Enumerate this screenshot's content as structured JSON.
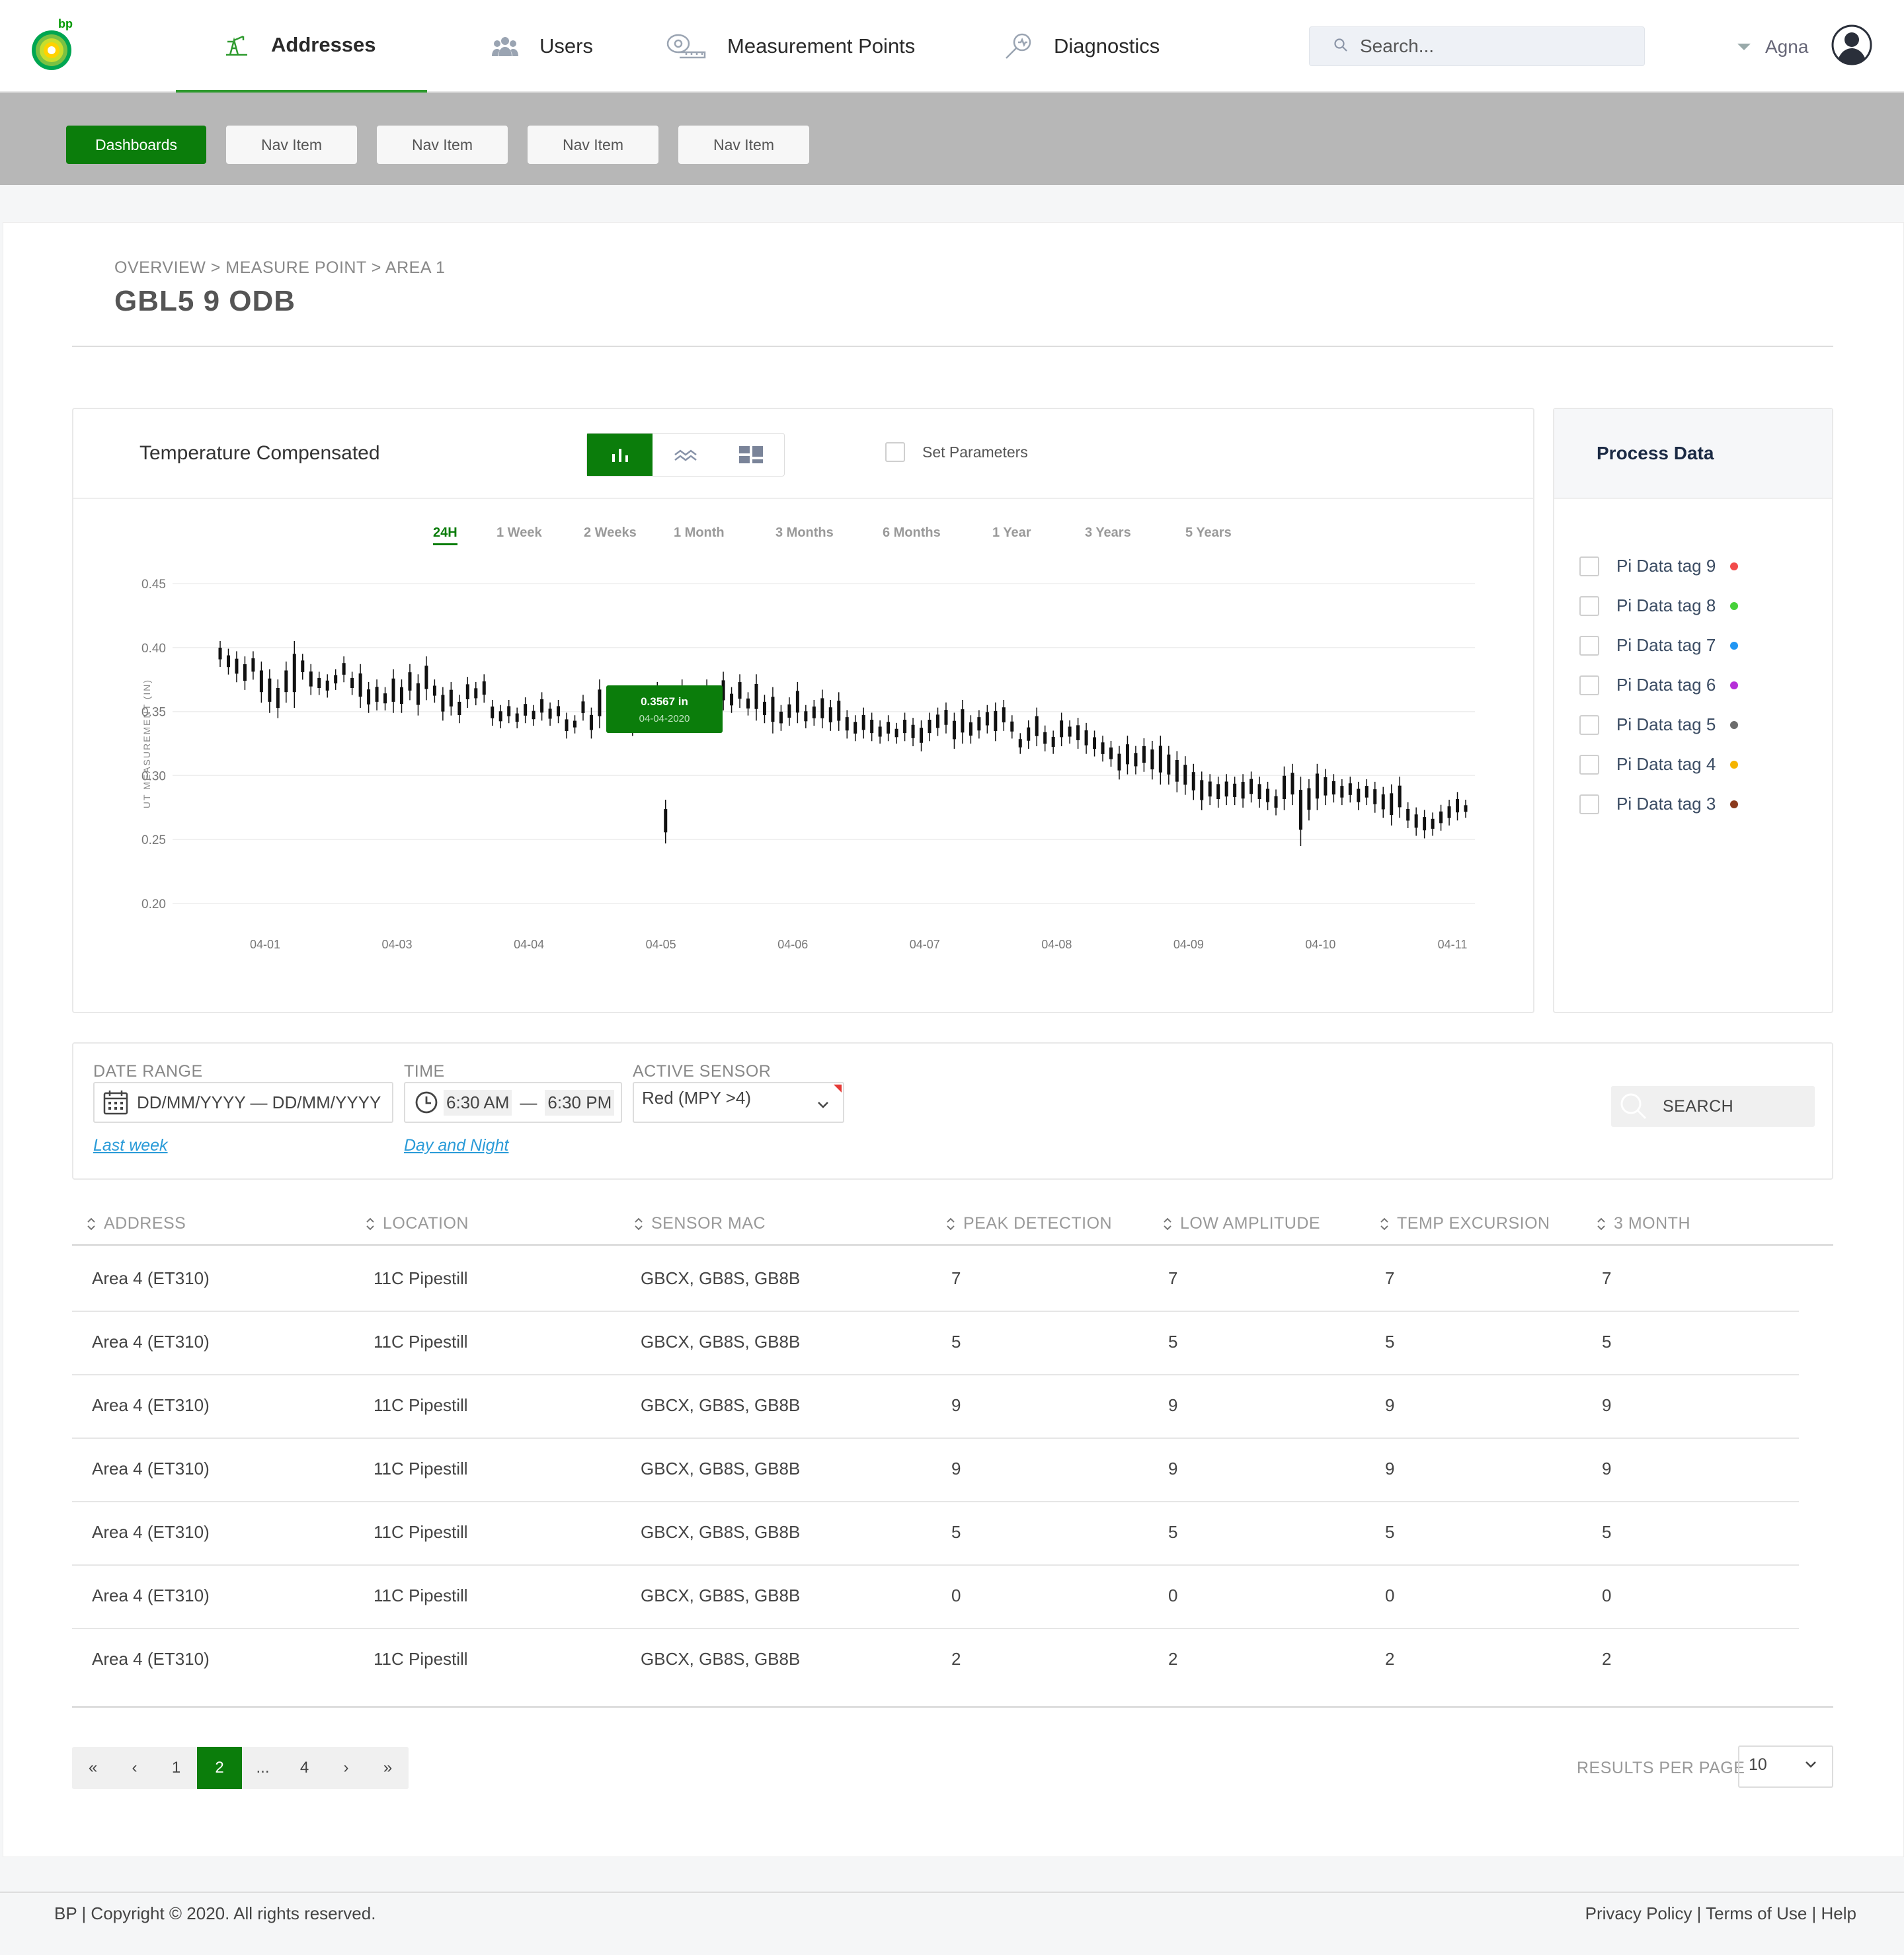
{
  "brand": {
    "logo_text": "bp",
    "accent": "#0b7d0b",
    "icon": "bp-helios-logo"
  },
  "nav": {
    "tabs": [
      {
        "label": "Addresses",
        "icon": "oil-pump-icon",
        "active": true
      },
      {
        "label": "Users",
        "icon": "users-icon",
        "active": false
      },
      {
        "label": "Measurement Points",
        "icon": "tape-measure-icon",
        "active": false
      },
      {
        "label": "Diagnostics",
        "icon": "diagnostics-icon",
        "active": false
      }
    ],
    "search_placeholder": "Search...",
    "user_name": "Agna"
  },
  "subnav": {
    "items": [
      {
        "label": "Dashboards",
        "active": true
      },
      {
        "label": "Nav Item",
        "active": false
      },
      {
        "label": "Nav Item",
        "active": false
      },
      {
        "label": "Nav Item",
        "active": false
      },
      {
        "label": "Nav Item",
        "active": false
      }
    ]
  },
  "page": {
    "breadcrumb": "OVERVIEW > MEASURE POINT > AREA 1",
    "title": "GBL5 9 ODB"
  },
  "chart_panel": {
    "title": "Temperature Compensated",
    "set_parameters_label": "Set Parameters",
    "ranges": [
      "24H",
      "1 Week",
      "2 Weeks",
      "1 Month",
      "3 Months",
      "6 Months",
      "1 Year",
      "3 Years",
      "5 Years"
    ],
    "active_range": "24H",
    "tooltip_value": "0.3567 in",
    "tooltip_date": "04-04-2020"
  },
  "chart_data": {
    "type": "candlestick",
    "ylabel": "UT MEASUREMENT (IN)",
    "ylim": [
      0.2,
      0.45
    ],
    "yticks": [
      "0.45",
      "0.40",
      "0.35",
      "0.30",
      "0.25",
      "0.20"
    ],
    "xticks": [
      "04-01",
      "04-03",
      "04-04",
      "04-05",
      "04-06",
      "04-07",
      "04-08",
      "04-09",
      "04-10",
      "04-11"
    ],
    "grid": true,
    "candles": [
      [
        0.402,
        0.388
      ],
      [
        0.396,
        0.382
      ],
      [
        0.394,
        0.376
      ],
      [
        0.39,
        0.37
      ],
      [
        0.394,
        0.378
      ],
      [
        0.386,
        0.36
      ],
      [
        0.38,
        0.352
      ],
      [
        0.372,
        0.348
      ],
      [
        0.386,
        0.36
      ],
      [
        0.402,
        0.356
      ],
      [
        0.392,
        0.378
      ],
      [
        0.384,
        0.366
      ],
      [
        0.378,
        0.366
      ],
      [
        0.376,
        0.364
      ],
      [
        0.38,
        0.37
      ],
      [
        0.39,
        0.376
      ],
      [
        0.378,
        0.366
      ],
      [
        0.384,
        0.356
      ],
      [
        0.37,
        0.352
      ],
      [
        0.372,
        0.354
      ],
      [
        0.366,
        0.354
      ],
      [
        0.38,
        0.352
      ],
      [
        0.372,
        0.352
      ],
      [
        0.384,
        0.362
      ],
      [
        0.376,
        0.35
      ],
      [
        0.39,
        0.362
      ],
      [
        0.372,
        0.36
      ],
      [
        0.366,
        0.346
      ],
      [
        0.37,
        0.35
      ],
      [
        0.36,
        0.344
      ],
      [
        0.374,
        0.356
      ],
      [
        0.37,
        0.358
      ],
      [
        0.376,
        0.36
      ],
      [
        0.356,
        0.342
      ],
      [
        0.352,
        0.34
      ],
      [
        0.356,
        0.344
      ],
      [
        0.35,
        0.34
      ],
      [
        0.358,
        0.344
      ],
      [
        0.352,
        0.342
      ],
      [
        0.362,
        0.346
      ],
      [
        0.354,
        0.342
      ],
      [
        0.356,
        0.344
      ],
      [
        0.346,
        0.332
      ],
      [
        0.344,
        0.336
      ],
      [
        0.36,
        0.346
      ],
      [
        0.35,
        0.332
      ],
      [
        0.372,
        0.34
      ],
      [
        0.366,
        0.346
      ],
      [
        0.352,
        0.338
      ],
      [
        0.348,
        0.34
      ],
      [
        0.346,
        0.334
      ],
      [
        0.35,
        0.342
      ],
      [
        0.362,
        0.346
      ],
      [
        0.37,
        0.352
      ],
      [
        0.278,
        0.25
      ],
      [
        0.362,
        0.348
      ],
      [
        0.372,
        0.352
      ],
      [
        0.366,
        0.35
      ],
      [
        0.36,
        0.34
      ],
      [
        0.372,
        0.354
      ],
      [
        0.356,
        0.346
      ],
      [
        0.378,
        0.354
      ],
      [
        0.366,
        0.352
      ],
      [
        0.376,
        0.356
      ],
      [
        0.362,
        0.35
      ],
      [
        0.376,
        0.346
      ],
      [
        0.36,
        0.344
      ],
      [
        0.366,
        0.336
      ],
      [
        0.352,
        0.338
      ],
      [
        0.358,
        0.342
      ],
      [
        0.37,
        0.344
      ],
      [
        0.352,
        0.34
      ],
      [
        0.356,
        0.342
      ],
      [
        0.364,
        0.34
      ],
      [
        0.356,
        0.338
      ],
      [
        0.362,
        0.338
      ],
      [
        0.348,
        0.332
      ],
      [
        0.344,
        0.33
      ],
      [
        0.35,
        0.332
      ],
      [
        0.346,
        0.33
      ],
      [
        0.34,
        0.328
      ],
      [
        0.344,
        0.33
      ],
      [
        0.338,
        0.328
      ],
      [
        0.346,
        0.33
      ],
      [
        0.342,
        0.326
      ],
      [
        0.34,
        0.322
      ],
      [
        0.346,
        0.33
      ],
      [
        0.35,
        0.334
      ],
      [
        0.354,
        0.336
      ],
      [
        0.346,
        0.324
      ],
      [
        0.356,
        0.328
      ],
      [
        0.344,
        0.328
      ],
      [
        0.348,
        0.332
      ],
      [
        0.352,
        0.336
      ],
      [
        0.354,
        0.33
      ],
      [
        0.356,
        0.338
      ],
      [
        0.344,
        0.332
      ],
      [
        0.33,
        0.32
      ],
      [
        0.34,
        0.324
      ],
      [
        0.35,
        0.326
      ],
      [
        0.336,
        0.322
      ],
      [
        0.332,
        0.32
      ],
      [
        0.346,
        0.326
      ],
      [
        0.34,
        0.328
      ],
      [
        0.342,
        0.324
      ],
      [
        0.338,
        0.32
      ],
      [
        0.332,
        0.318
      ],
      [
        0.328,
        0.314
      ],
      [
        0.324,
        0.31
      ],
      [
        0.32,
        0.3
      ],
      [
        0.328,
        0.304
      ],
      [
        0.32,
        0.304
      ],
      [
        0.326,
        0.306
      ],
      [
        0.324,
        0.3
      ],
      [
        0.328,
        0.296
      ],
      [
        0.32,
        0.296
      ],
      [
        0.316,
        0.29
      ],
      [
        0.312,
        0.288
      ],
      [
        0.306,
        0.284
      ],
      [
        0.3,
        0.276
      ],
      [
        0.298,
        0.28
      ],
      [
        0.296,
        0.278
      ],
      [
        0.298,
        0.28
      ],
      [
        0.296,
        0.28
      ],
      [
        0.298,
        0.278
      ],
      [
        0.3,
        0.282
      ],
      [
        0.296,
        0.278
      ],
      [
        0.292,
        0.276
      ],
      [
        0.286,
        0.272
      ],
      [
        0.304,
        0.276
      ],
      [
        0.306,
        0.28
      ],
      [
        0.296,
        0.248
      ],
      [
        0.294,
        0.268
      ],
      [
        0.306,
        0.276
      ],
      [
        0.302,
        0.28
      ],
      [
        0.298,
        0.282
      ],
      [
        0.294,
        0.28
      ],
      [
        0.296,
        0.282
      ],
      [
        0.292,
        0.276
      ],
      [
        0.294,
        0.28
      ],
      [
        0.292,
        0.274
      ],
      [
        0.288,
        0.27
      ],
      [
        0.29,
        0.264
      ],
      [
        0.296,
        0.27
      ],
      [
        0.276,
        0.262
      ],
      [
        0.272,
        0.256
      ],
      [
        0.27,
        0.254
      ],
      [
        0.268,
        0.256
      ],
      [
        0.274,
        0.26
      ],
      [
        0.278,
        0.264
      ],
      [
        0.284,
        0.268
      ],
      [
        0.278,
        0.27
      ]
    ]
  },
  "process_data": {
    "title": "Process Data",
    "tags": [
      {
        "label": "Pi Data tag  9",
        "color": "#f24b4b"
      },
      {
        "label": "Pi Data tag  8",
        "color": "#47d13a"
      },
      {
        "label": "Pi Data tag  7",
        "color": "#2196f3"
      },
      {
        "label": "Pi Data tag  6",
        "color": "#b62fd8"
      },
      {
        "label": "Pi Data tag  5",
        "color": "#6d6d6d"
      },
      {
        "label": "Pi Data tag  4",
        "color": "#f5b400"
      },
      {
        "label": "Pi Data tag  3",
        "color": "#8b3a1d"
      }
    ]
  },
  "filters": {
    "date_range_label": "DATE RANGE",
    "date_range_value": "DD/MM/YYYY — DD/MM/YYYY",
    "date_link": "Last week",
    "time_label": "TIME",
    "time_from": "6:30 AM",
    "time_sep": "—",
    "time_to": "6:30 PM",
    "time_link": "Day and Night",
    "sensor_label": "ACTIVE SENSOR",
    "sensor_value": "Red (MPY >4)",
    "search_button": "SEARCH"
  },
  "table": {
    "headers": [
      "ADDRESS",
      "LOCATION",
      "SENSOR MAC",
      "PEAK DETECTION",
      "LOW AMPLITUDE",
      "TEMP EXCURSION",
      "3 MONTH"
    ],
    "rows": [
      [
        "Area 4 (ET310)",
        "11C Pipestill",
        "GBCX, GB8S, GB8B",
        "7",
        "7",
        "7",
        "7"
      ],
      [
        "Area 4 (ET310)",
        "11C Pipestill",
        "GBCX, GB8S, GB8B",
        "5",
        "5",
        "5",
        "5"
      ],
      [
        "Area 4 (ET310)",
        "11C Pipestill",
        "GBCX, GB8S, GB8B",
        "9",
        "9",
        "9",
        "9"
      ],
      [
        "Area 4 (ET310)",
        "11C Pipestill",
        "GBCX, GB8S, GB8B",
        "9",
        "9",
        "9",
        "9"
      ],
      [
        "Area 4 (ET310)",
        "11C Pipestill",
        "GBCX, GB8S, GB8B",
        "5",
        "5",
        "5",
        "5"
      ],
      [
        "Area 4 (ET310)",
        "11C Pipestill",
        "GBCX, GB8S, GB8B",
        "0",
        "0",
        "0",
        "0"
      ],
      [
        "Area 4 (ET310)",
        "11C Pipestill",
        "GBCX, GB8S, GB8B",
        "2",
        "2",
        "2",
        "2"
      ]
    ]
  },
  "pagination": {
    "items": [
      "«",
      "‹",
      "1",
      "2",
      "...",
      "4",
      "›",
      "»"
    ],
    "current": "2",
    "results_label": "RESULTS PER PAGE",
    "results_value": "10"
  },
  "footer": {
    "left": "BP |  Copyright © 2020. All rights reserved.",
    "right": "Privacy Policy | Terms of Use | Help"
  }
}
